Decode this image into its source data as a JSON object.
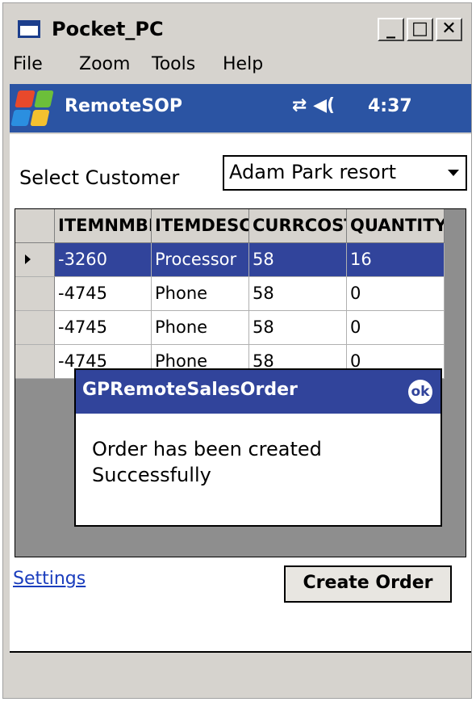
{
  "window": {
    "title": "Pocket_PC",
    "controls": {
      "minimize": "_",
      "maximize": "□",
      "close": "✕"
    }
  },
  "menu": {
    "items": [
      "File",
      "Zoom",
      "Tools",
      "Help"
    ]
  },
  "navbar": {
    "app_name": "RemoteSOP",
    "status_icons": "⇄ ◀(",
    "time": "4:37",
    "start_icon_colors": [
      "#e8492b",
      "#6cbf3a",
      "#2b8fe0",
      "#f4c12f"
    ]
  },
  "form": {
    "select_customer_label": "Select Customer",
    "customer_value": "Adam Park resort"
  },
  "grid": {
    "columns": [
      "ITEMNMBR",
      "ITEMDESC",
      "CURRCOST",
      "QUANTITY"
    ],
    "rows": [
      [
        "-3260",
        "Processor",
        "58",
        "16"
      ],
      [
        "-4745",
        "Phone",
        "58",
        "0"
      ],
      [
        "-4745",
        "Phone",
        "58",
        "0"
      ],
      [
        "-4745",
        "Phone",
        "58",
        "0"
      ]
    ],
    "selected_row": 0
  },
  "dialog": {
    "title": "GPRemoteSalesOrder",
    "ok_label": "ok",
    "message": "Order has been created Successfully"
  },
  "footer": {
    "settings_label": "Settings",
    "create_order_label": "Create Order"
  }
}
